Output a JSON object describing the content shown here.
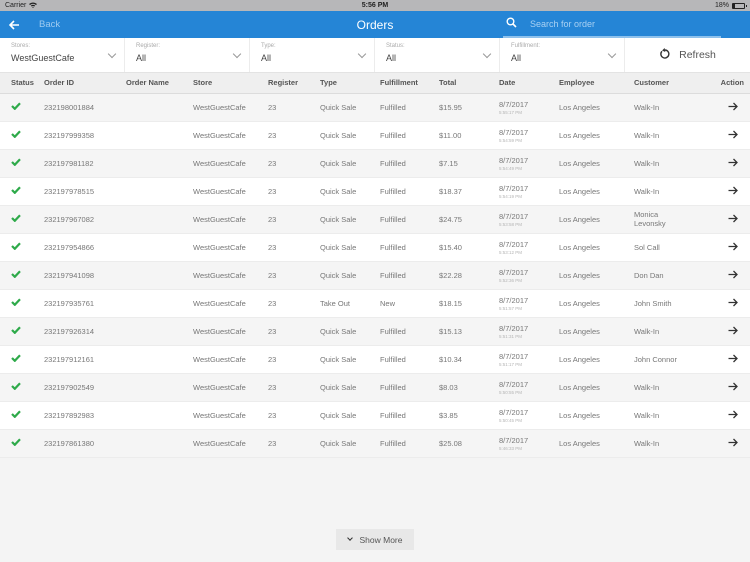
{
  "status_bar": {
    "carrier": "Carrier",
    "time": "5:56 PM",
    "battery": "18%",
    "battery_level": 0.18
  },
  "nav": {
    "back_label": "Back",
    "title": "Orders",
    "search_placeholder": "Search for order"
  },
  "filters": [
    {
      "label": "Stores:",
      "value": "WestGuestCafe"
    },
    {
      "label": "Register:",
      "value": "All"
    },
    {
      "label": "Type:",
      "value": "All"
    },
    {
      "label": "Status:",
      "value": "All"
    },
    {
      "label": "Fulfillment:",
      "value": "All"
    }
  ],
  "refresh_label": "Refresh",
  "columns": [
    "Status",
    "Order ID",
    "Order Name",
    "Store",
    "Register",
    "Type",
    "Fulfillment",
    "Total",
    "Date",
    "Employee",
    "Customer",
    "Action"
  ],
  "orders": [
    {
      "status": "complete",
      "order_id": "232198001884",
      "order_name": "",
      "store": "WestGuestCafe",
      "register": "23",
      "type": "Quick Sale",
      "fulfillment": "Fulfilled",
      "total": "$15.95",
      "date": "8/7/2017",
      "time": "5:55:17 PM",
      "employee": "Los Angeles",
      "customer": "Walk-In"
    },
    {
      "status": "complete",
      "order_id": "232197999358",
      "order_name": "",
      "store": "WestGuestCafe",
      "register": "23",
      "type": "Quick Sale",
      "fulfillment": "Fulfilled",
      "total": "$11.00",
      "date": "8/7/2017",
      "time": "5:54:59 PM",
      "employee": "Los Angeles",
      "customer": "Walk-In"
    },
    {
      "status": "complete",
      "order_id": "232197981182",
      "order_name": "",
      "store": "WestGuestCafe",
      "register": "23",
      "type": "Quick Sale",
      "fulfillment": "Fulfilled",
      "total": "$7.15",
      "date": "8/7/2017",
      "time": "5:54:49 PM",
      "employee": "Los Angeles",
      "customer": "Walk-In"
    },
    {
      "status": "complete",
      "order_id": "232197978515",
      "order_name": "",
      "store": "WestGuestCafe",
      "register": "23",
      "type": "Quick Sale",
      "fulfillment": "Fulfilled",
      "total": "$18.37",
      "date": "8/7/2017",
      "time": "5:54:19 PM",
      "employee": "Los Angeles",
      "customer": "Walk-In"
    },
    {
      "status": "complete",
      "order_id": "232197967082",
      "order_name": "",
      "store": "WestGuestCafe",
      "register": "23",
      "type": "Quick Sale",
      "fulfillment": "Fulfilled",
      "total": "$24.75",
      "date": "8/7/2017",
      "time": "5:53:58 PM",
      "employee": "Los Angeles",
      "customer": "Monica Levonsky"
    },
    {
      "status": "complete",
      "order_id": "232197954866",
      "order_name": "",
      "store": "WestGuestCafe",
      "register": "23",
      "type": "Quick Sale",
      "fulfillment": "Fulfilled",
      "total": "$15.40",
      "date": "8/7/2017",
      "time": "5:53:12 PM",
      "employee": "Los Angeles",
      "customer": "Sol Call"
    },
    {
      "status": "complete",
      "order_id": "232197941098",
      "order_name": "",
      "store": "WestGuestCafe",
      "register": "23",
      "type": "Quick Sale",
      "fulfillment": "Fulfilled",
      "total": "$22.28",
      "date": "8/7/2017",
      "time": "5:52:36 PM",
      "employee": "Los Angeles",
      "customer": "Don Dan"
    },
    {
      "status": "complete",
      "order_id": "232197935761",
      "order_name": "",
      "store": "WestGuestCafe",
      "register": "23",
      "type": "Take Out",
      "fulfillment": "New",
      "total": "$18.15",
      "date": "8/7/2017",
      "time": "5:51:57 PM",
      "employee": "Los Angeles",
      "customer": "John Smith"
    },
    {
      "status": "complete",
      "order_id": "232197926314",
      "order_name": "",
      "store": "WestGuestCafe",
      "register": "23",
      "type": "Quick Sale",
      "fulfillment": "Fulfilled",
      "total": "$15.13",
      "date": "8/7/2017",
      "time": "5:51:31 PM",
      "employee": "Los Angeles",
      "customer": "Walk-In"
    },
    {
      "status": "complete",
      "order_id": "232197912161",
      "order_name": "",
      "store": "WestGuestCafe",
      "register": "23",
      "type": "Quick Sale",
      "fulfillment": "Fulfilled",
      "total": "$10.34",
      "date": "8/7/2017",
      "time": "5:51:17 PM",
      "employee": "Los Angeles",
      "customer": "John Connor"
    },
    {
      "status": "complete",
      "order_id": "232197902549",
      "order_name": "",
      "store": "WestGuestCafe",
      "register": "23",
      "type": "Quick Sale",
      "fulfillment": "Fulfilled",
      "total": "$8.03",
      "date": "8/7/2017",
      "time": "5:50:55 PM",
      "employee": "Los Angeles",
      "customer": "Walk-In"
    },
    {
      "status": "complete",
      "order_id": "232197892983",
      "order_name": "",
      "store": "WestGuestCafe",
      "register": "23",
      "type": "Quick Sale",
      "fulfillment": "Fulfilled",
      "total": "$3.85",
      "date": "8/7/2017",
      "time": "5:50:45 PM",
      "employee": "Los Angeles",
      "customer": "Walk-In"
    },
    {
      "status": "complete",
      "order_id": "232197861380",
      "order_name": "",
      "store": "WestGuestCafe",
      "register": "23",
      "type": "Quick Sale",
      "fulfillment": "Fulfilled",
      "total": "$25.08",
      "date": "8/7/2017",
      "time": "5:46:33 PM",
      "employee": "Los Angeles",
      "customer": "Walk-In"
    }
  ],
  "show_more_label": "Show More"
}
